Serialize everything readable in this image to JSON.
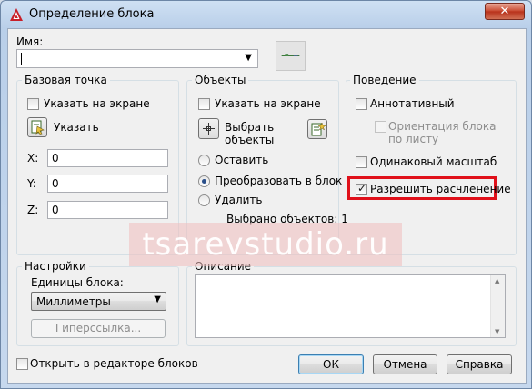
{
  "window": {
    "title": "Определение блока",
    "close_label": "✕"
  },
  "name": {
    "label": "Имя:",
    "value": ""
  },
  "base_point": {
    "title": "Базовая точка",
    "specify_on_screen": "Указать на экране",
    "pick_button": "Указать",
    "x_label": "X:",
    "x_value": "0",
    "y_label": "Y:",
    "y_value": "0",
    "z_label": "Z:",
    "z_value": "0"
  },
  "objects": {
    "title": "Объекты",
    "specify_on_screen": "Указать на экране",
    "select_objects_line1": "Выбрать",
    "select_objects_line2": "объекты",
    "retain": "Оставить",
    "convert": "Преобразовать в блок",
    "delete": "Удалить",
    "selected_count": "Выбрано объектов: 1",
    "selected_mode": "convert"
  },
  "behavior": {
    "title": "Поведение",
    "annotative": "Аннотативный",
    "orientation_line1": "Ориентация блока",
    "orientation_line2": "по листу",
    "uniform_scale": "Одинаковый масштаб",
    "allow_explode": "Разрешить расчленение",
    "allow_explode_checked": true,
    "highlight_color": "#e0101a"
  },
  "settings": {
    "title": "Настройки",
    "units_label": "Единицы блока:",
    "units_value": "Миллиметры",
    "hyperlink_button": "Гиперссылка..."
  },
  "description": {
    "title": "Описание",
    "value": ""
  },
  "footer": {
    "open_in_editor": "Открыть в редакторе блоков",
    "ok": "ОК",
    "cancel": "Отмена",
    "help": "Справка"
  },
  "watermark": "tsarevstudio.ru"
}
